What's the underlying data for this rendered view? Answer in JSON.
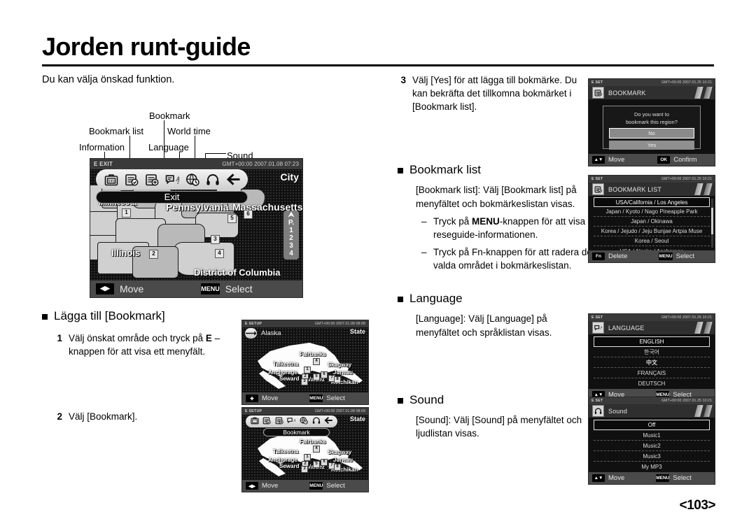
{
  "header": {
    "title": "Jorden runt-guide",
    "page_label": "<103>"
  },
  "left": {
    "intro": "Du kan välja önskad funktion.",
    "callouts": [
      {
        "name": "information",
        "label": "Information"
      },
      {
        "name": "bookmark-list",
        "label": "Bookmark list"
      },
      {
        "name": "bookmark",
        "label": "Bookmark"
      },
      {
        "name": "language",
        "label": "Language"
      },
      {
        "name": "world-time",
        "label": "World time"
      },
      {
        "name": "sound",
        "label": "Sound"
      }
    ],
    "section_add_bookmark": {
      "heading": "Lägga till [Bookmark]",
      "step1_num": "1",
      "step1_text": "Välj önskat område och tryck på E – knappen för att visa ett menyfält.",
      "step1_text_a": "Välj önskat område och tryck på ",
      "step1_bold": "E",
      "step1_text_b": " – knappen för att visa ett menyfält.",
      "step2_num": "2",
      "step2_text": "Välj [Bookmark]."
    }
  },
  "right": {
    "step3_num": "3",
    "step3_text": "Välj [Yes] för att lägga till bokmärke. Du kan bekräfta det tillkomna bokmärket i [Bookmark list].",
    "section_bookmark_list": {
      "heading": "Bookmark list",
      "para": "[Bookmark list]: Välj [Bookmark list] på menyfältet och bokmärkeslistan visas.",
      "dash1_a": "Tryck på ",
      "dash1_bold": "MENU",
      "dash1_b": "-knappen för att visa reseguide-informationen.",
      "dash2": "Tryck på Fn-knappen för att radera det valda området i bokmärkeslistan."
    },
    "section_language": {
      "heading": "Language",
      "para": "[Language]: Välj [Language] på menyfältet och språklistan visas."
    },
    "section_sound": {
      "heading": "Sound",
      "para": "[Sound]: Välj [Sound] på menyfältet och ljudlistan visas."
    }
  },
  "lcd_main": {
    "status_left": "E EXIT",
    "status_right": "GMT+00:00 2007.01.08 07:23",
    "highlight_label": "Exit",
    "city_badge": "City",
    "pager_label": "P.",
    "pager_pages": [
      "1",
      "2",
      "3",
      "4"
    ],
    "bottom_move_label": "Move",
    "bottom_menu_key": "MENU",
    "bottom_select_label": "Select",
    "menu_icons": [
      "info-icon",
      "bookmark-list-icon",
      "bookmark-add-icon",
      "language-icon",
      "world-time-icon",
      "sound-icon",
      "exit-icon"
    ],
    "state_labels": [
      {
        "name": "minnesota",
        "text": "Minnesota"
      },
      {
        "name": "illinois",
        "text": "Illinois"
      },
      {
        "name": "pennsylvania",
        "text": "Pennsylvania"
      },
      {
        "name": "massachusetts",
        "text": "Massachusetts"
      },
      {
        "name": "district-of-columbia",
        "text": "District of Columbia"
      }
    ],
    "numbered_markers": [
      "1",
      "2",
      "3",
      "4",
      "5",
      "6"
    ]
  },
  "lcd_alaska_1": {
    "status_left": "E SETUP",
    "status_right": "GMT+00:00 2007.01.08 08:08",
    "state_name": "Alaska",
    "state_badge": "State",
    "bottom_move_label": "Move",
    "bottom_menu_key": "MENU",
    "bottom_select_label": "Select",
    "cities": [
      "Fairbanks",
      "Talkeetna",
      "Anchorage",
      "Seward",
      "Valdez",
      "Skagway",
      "Juneau",
      "Ketchikan"
    ]
  },
  "lcd_alaska_2": {
    "status_left": "E SETUP",
    "status_right": "GMT+00:00 2007.01.08 08:09",
    "highlight_label": "Bookmark",
    "state_badge": "State",
    "bottom_move_label": "Move",
    "bottom_menu_key": "MENU",
    "bottom_select_label": "Select",
    "cities": [
      "Fairbanks",
      "Talkeetna",
      "Anchorage",
      "Seward",
      "Valdez",
      "Skagway",
      "Juneau",
      "Ketchikan"
    ]
  },
  "lcd_bookmark_confirm": {
    "status_left": "E SET",
    "status_right": "GMT+00:00 2007.01.25 10:21",
    "title": "BOOKMARK",
    "title_icon": "bookmark-add-icon",
    "message_line1": "Do you want to",
    "message_line2": "bookmark this region?",
    "button_no": "No",
    "button_yes": "Yes",
    "bottom_move_label": "Move",
    "bottom_ok_key": "OK",
    "bottom_confirm_label": "Confirm"
  },
  "lcd_bookmark_list": {
    "status_left": "E SET",
    "status_right": "GMT+00:00 2007.01.25 10:21",
    "title": "BOOKMARK LIST",
    "title_icon": "bookmark-list-icon",
    "items": [
      "USA/California / Los Angeles",
      "Japan / Kyoto / Nago Pineapple Park",
      "Japan / Okinawa",
      "Korea / Jejudo / Jeju Bunjae Artpia Muse",
      "Korea / Seoul",
      "USA / Alaska / Anchorage"
    ],
    "selected_index": 0,
    "bottom_fn_key": "Fn",
    "bottom_delete_label": "Delete",
    "bottom_menu_key": "MENU",
    "bottom_select_label": "Select"
  },
  "lcd_language": {
    "status_left": "E SET",
    "status_right": "GMT+00:00 2007.01.25 10:21",
    "title": "LANGUAGE",
    "title_icon": "language-icon",
    "items": [
      "ENGLISH",
      "한국어",
      "中文",
      "FRANÇAIS",
      "DEUTSCH"
    ],
    "selected_index": 0,
    "bottom_move_label": "Move",
    "bottom_menu_key": "MENU",
    "bottom_select_label": "Select"
  },
  "lcd_sound": {
    "status_left": "E SET",
    "status_right": "GMT+00:00 2007.01.25 10:21",
    "title": "Sound",
    "title_icon": "sound-icon",
    "items": [
      "Off",
      "Music1",
      "Music2",
      "Music3",
      "My MP3"
    ],
    "selected_index": 0,
    "bottom_move_label": "Move",
    "bottom_menu_key": "MENU",
    "bottom_select_label": "Select"
  }
}
